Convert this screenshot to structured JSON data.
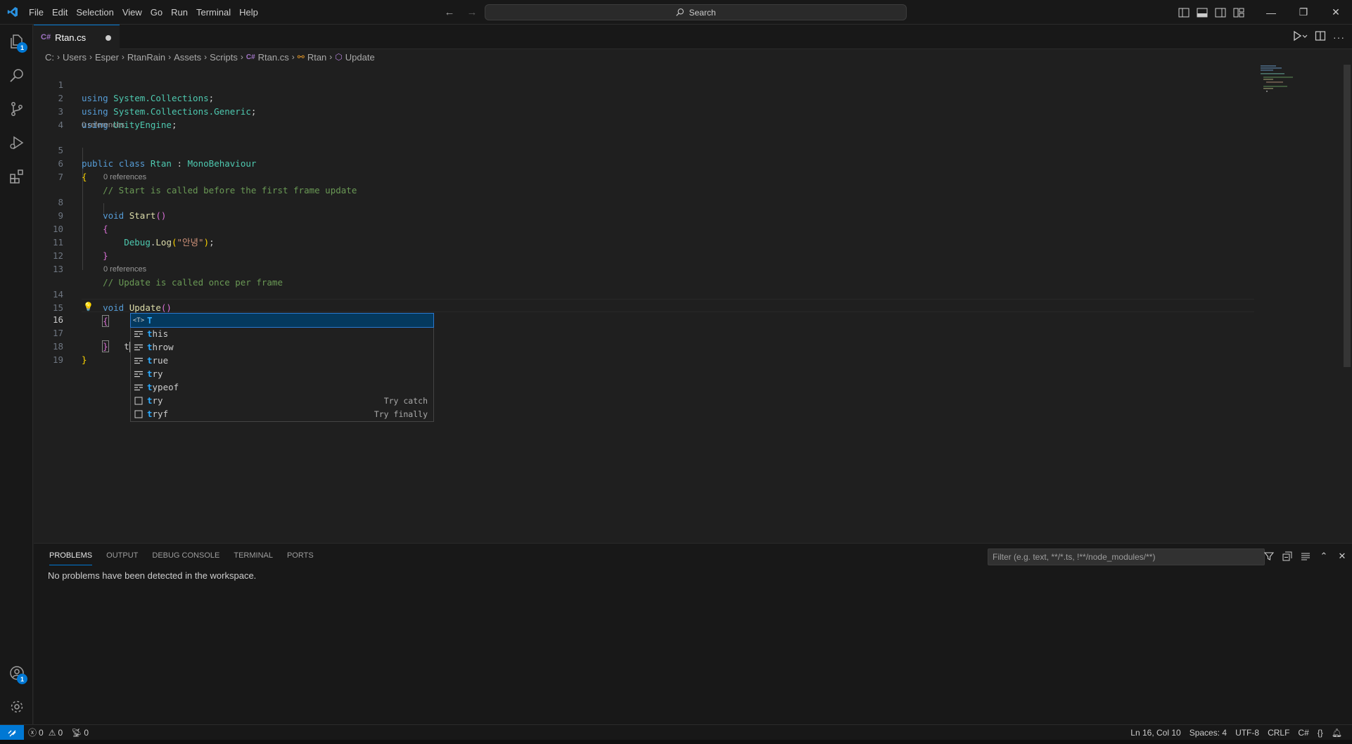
{
  "window": {
    "search_placeholder": "Search"
  },
  "menu": [
    "File",
    "Edit",
    "Selection",
    "View",
    "Go",
    "Run",
    "Terminal",
    "Help"
  ],
  "activity_bar": {
    "explorer_badge": "1",
    "accounts_badge": "1"
  },
  "tab": {
    "label": "Rtan.cs"
  },
  "breadcrumb": [
    "C:",
    "Users",
    "Esper",
    "RtanRain",
    "Assets",
    "Scripts",
    "Rtan.cs",
    "Rtan",
    "Update"
  ],
  "code": {
    "codelens": "0 references",
    "line_numbers": [
      "1",
      "2",
      "3",
      "4",
      "5",
      "6",
      "7",
      "8",
      "9",
      "10",
      "11",
      "12",
      "13",
      "14",
      "15",
      "16",
      "17",
      "18",
      "19"
    ],
    "l1_kw": "using",
    "l1_ns": "System.Collections",
    "l1_end": ";",
    "l2_kw": "using",
    "l2_ns": "System.Collections.Generic",
    "l2_end": ";",
    "l3_kw": "using",
    "l3_ns": "UnityEngine",
    "l3_end": ";",
    "l5_kw1": "public",
    "l5_kw2": "class",
    "l5_name": "Rtan",
    "l5_colon": ":",
    "l5_base": "MonoBehaviour",
    "l6_brace": "{",
    "l7_comment": "// Start is called before the first frame update",
    "l8_kw": "void",
    "l8_fn": "Start",
    "l8_paren": "()",
    "l9_brace": "{",
    "l10_obj": "Debug",
    "l10_dot": ".",
    "l10_fn": "Log",
    "l10_open": "(",
    "l10_str": "\"안녕\"",
    "l10_close": ")",
    "l10_end": ";",
    "l11_brace": "}",
    "l13_comment": "// Update is called once per frame",
    "l14_kw": "void",
    "l14_fn": "Update",
    "l14_paren": "()",
    "l15_brace": "{",
    "l16_text": "t",
    "l17_brace": "}",
    "l18_brace": "}"
  },
  "suggestions": [
    {
      "icon": "type-parameter-icon",
      "match": "T",
      "rest": "",
      "detail": ""
    },
    {
      "icon": "keyword-icon",
      "match": "t",
      "rest": "his",
      "detail": ""
    },
    {
      "icon": "keyword-icon",
      "match": "t",
      "rest": "hrow",
      "detail": ""
    },
    {
      "icon": "keyword-icon",
      "match": "t",
      "rest": "rue",
      "detail": ""
    },
    {
      "icon": "keyword-icon",
      "match": "t",
      "rest": "ry",
      "detail": ""
    },
    {
      "icon": "keyword-icon",
      "match": "t",
      "rest": "ypeof",
      "detail": ""
    },
    {
      "icon": "snippet-icon",
      "match": "t",
      "rest": "ry",
      "detail": "Try catch"
    },
    {
      "icon": "snippet-icon",
      "match": "t",
      "rest": "ryf",
      "detail": "Try finally"
    }
  ],
  "panel": {
    "tabs": [
      "PROBLEMS",
      "OUTPUT",
      "DEBUG CONSOLE",
      "TERMINAL",
      "PORTS"
    ],
    "filter_placeholder": "Filter (e.g. text, **/*.ts, !**/node_modules/**)",
    "message": "No problems have been detected in the workspace."
  },
  "status": {
    "errors": "0",
    "warnings": "0",
    "ports": "0",
    "cursor": "Ln 16, Col 10",
    "spaces": "Spaces: 4",
    "encoding": "UTF-8",
    "eol": "CRLF",
    "language": "C#"
  },
  "colors": {
    "accent": "#0078d4",
    "editor_bg": "#1f1f1f",
    "chrome_bg": "#181818"
  }
}
